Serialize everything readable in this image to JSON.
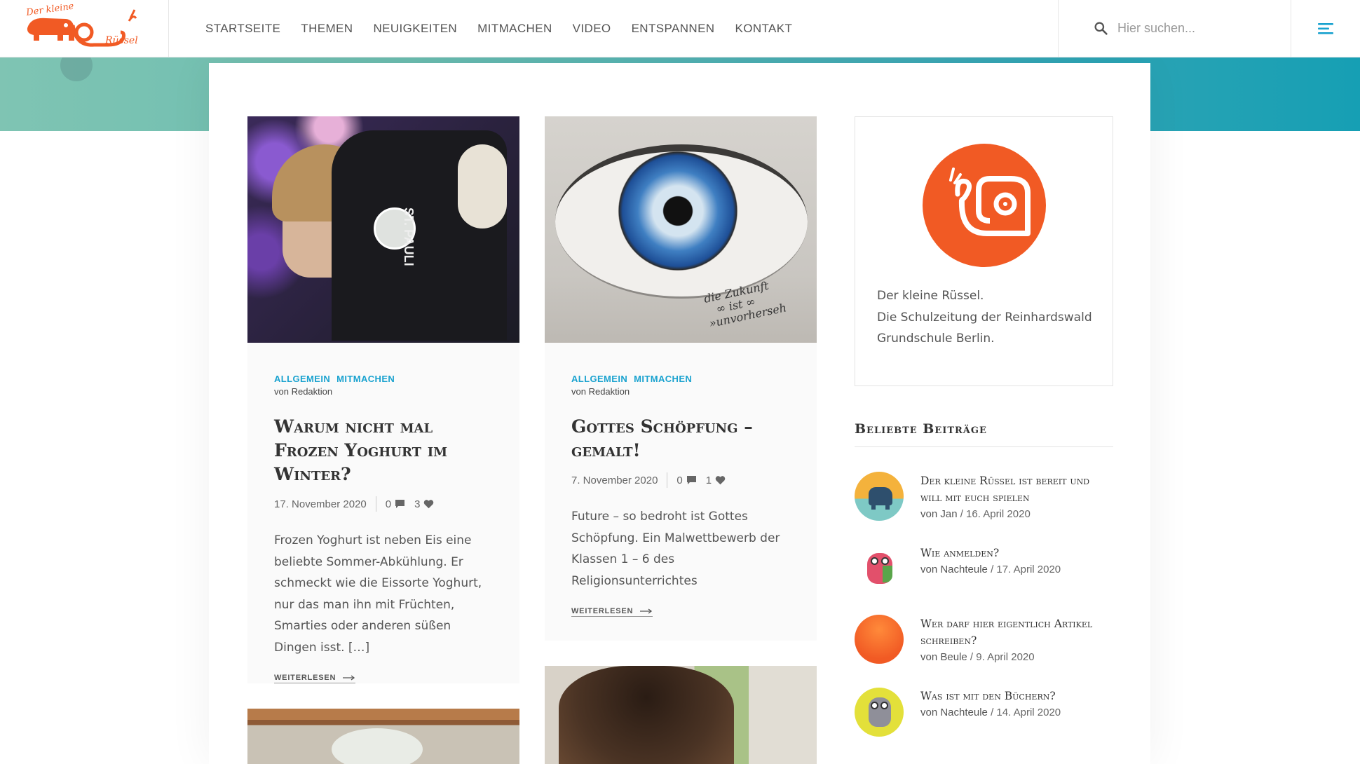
{
  "brand": {
    "logo_text_top": "Der kleine",
    "logo_text_bottom": "Rüssel",
    "accent": "#f15a24",
    "link": "#19a2cf"
  },
  "nav": {
    "items": [
      "STARTSEITE",
      "THEMEN",
      "NEUIGKEITEN",
      "MITMACHEN",
      "VIDEO",
      "ENTSPANNEN",
      "KONTAKT"
    ]
  },
  "search": {
    "placeholder": "Hier suchen..."
  },
  "posts": [
    {
      "categories": [
        "ALLGEMEIN",
        "MITMACHEN"
      ],
      "author": "von Redaktion",
      "title": "Warum nicht mal Frozen Yoghurt im Winter?",
      "date": "17. November 2020",
      "comments": "0",
      "likes": "3",
      "excerpt": "Frozen Yoghurt ist neben Eis eine beliebte Sommer-Abkühlung. Er schmeckt wie die Eissorte Yoghurt, nur das man ihn mit Früchten, Smarties oder anderen süßen Dingen isst. […]",
      "readmore": "WEITERLESEN",
      "image_shirt_text": "ST. PAULI"
    },
    {
      "categories": [
        "ALLGEMEIN",
        "MITMACHEN"
      ],
      "author": "von Redaktion",
      "title": "Gottes Schöpfung – gemalt!",
      "date": "7. November 2020",
      "comments": "0",
      "likes": "1",
      "excerpt": "Future – so bedroht ist Gottes Schöpfung. Ein Malwettbewerb der Klassen 1 – 6 des Religionsunterrichtes",
      "readmore": "WEITERLESEN",
      "image_handwriting": [
        "die Zukunft",
        "∞ ist ∞",
        "»unvorherseh"
      ]
    }
  ],
  "about": {
    "line1": "Der kleine Rüssel.",
    "line2": "Die Schulzeitung der Reinhardswald Grundschule Berlin."
  },
  "popular": {
    "title": "Beliebte Beiträge",
    "items": [
      {
        "title": "Der kleine Rüssel ist bereit und will mit euch spielen",
        "author": "von Jan",
        "date": "/ 16. April 2020"
      },
      {
        "title": "Wie anmelden?",
        "author": "von Nachteule",
        "date": "/ 17. April 2020"
      },
      {
        "title": "Wer darf hier eigentlich Artikel schreiben?",
        "author": "von Beule",
        "date": "/ 9. April 2020"
      },
      {
        "title": "Was ist mit den Büchern?",
        "author": "von Nachteule",
        "date": "/ 14. April 2020"
      }
    ]
  }
}
